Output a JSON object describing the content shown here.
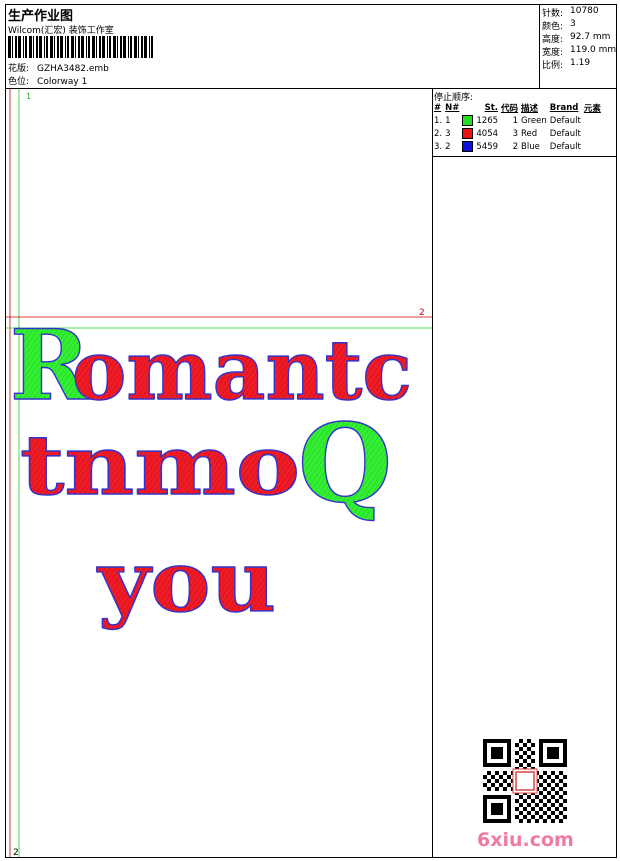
{
  "header": {
    "title": "生产作业图",
    "company": "Wilcom(汇宏) 装饰工作室",
    "design_label": "花版:",
    "design_value": "GZHA3482.emb",
    "colorway_label": "色位:",
    "colorway_value": "Colorway 1"
  },
  "stats": [
    {
      "label": "针数:",
      "value": "10780"
    },
    {
      "label": "颜色:",
      "value": "3"
    },
    {
      "label": "高度:",
      "value": "92.7 mm"
    },
    {
      "label": "宽度:",
      "value": "119.0 mm"
    },
    {
      "label": "比例:",
      "value": "1.19"
    }
  ],
  "sequence": {
    "title": "停止顺序:",
    "columns": [
      "#",
      "N#",
      "St.",
      "代码",
      "描述",
      "Brand",
      "元素"
    ],
    "rows": [
      {
        "n": "1.",
        "nn": "1",
        "color": "#22dd22",
        "code": "1265",
        "st": "1",
        "desc": "Green",
        "brand": "Default"
      },
      {
        "n": "2.",
        "nn": "3",
        "color": "#ee1111",
        "code": "4054",
        "st": "3",
        "desc": "Red",
        "brand": "Default"
      },
      {
        "n": "3.",
        "nn": "2",
        "color": "#1111dd",
        "code": "5459",
        "st": "2",
        "desc": "Blue",
        "brand": "Default"
      }
    ]
  },
  "canvas": {
    "marker_top": "1",
    "marker_right": "2",
    "marker_bottom": "2",
    "design_lines": [
      "Romantc",
      "tnmo",
      "you"
    ],
    "colors": {
      "fill_red": "#ee1c24",
      "fill_green": "#33ee33",
      "outline": "#3333cc"
    }
  },
  "watermark": "6xiu.com"
}
